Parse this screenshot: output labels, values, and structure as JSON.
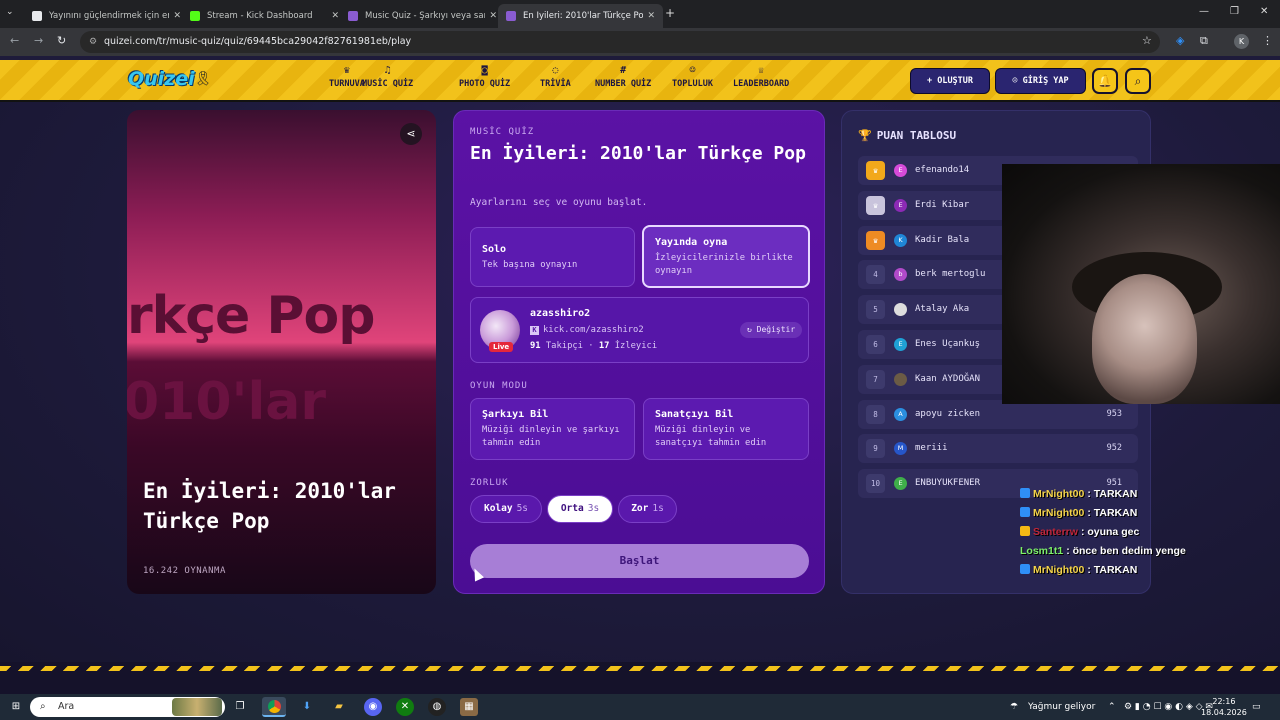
{
  "browser": {
    "tabs": [
      {
        "title": "Yayınını güçlendirmek için en iyi",
        "color": "#e8eaed"
      },
      {
        "title": "Stream - Kick Dashboard",
        "color": "#53fc18"
      },
      {
        "title": "Music Quiz - Şarkıyı veya sanatç",
        "color": "#8a5cd1"
      },
      {
        "title": "En İyileri: 2010'lar Türkçe Pop -",
        "color": "#8a5cd1"
      }
    ],
    "url": "quizei.com/tr/music-quiz/quiz/69445bca29042f82761981eb/play"
  },
  "site": {
    "logo": "Quizei",
    "nav": [
      {
        "icon": "♛",
        "label": "TURNUVA"
      },
      {
        "icon": "♫",
        "label": "MUSİC QUİZ"
      },
      {
        "icon": "◙",
        "label": "PHOTO QUİZ"
      },
      {
        "icon": "◌",
        "label": "TRİVİA"
      },
      {
        "icon": "#",
        "label": "NUMBER QUİZ"
      },
      {
        "icon": "☺",
        "label": "TOPLULUK"
      },
      {
        "icon": "♕",
        "label": "LEADERBOARD"
      }
    ],
    "create_label": "+ OLUŞTUR",
    "login_label": "GİRİŞ YAP"
  },
  "cover": {
    "bg_text1": "rkçe Pop",
    "bg_text2": "010'lar",
    "title": "En İyileri: 2010'lar Türkçe Pop",
    "plays": "16.242 OYNANMA"
  },
  "panel": {
    "kicker": "MUSİC QUİZ",
    "title": "En İyileri: 2010'lar Türkçe Pop",
    "subtitle": "Ayarlarını seç ve oyunu başlat.",
    "modes": [
      {
        "title": "Solo",
        "desc": "Tek başına oynayın"
      },
      {
        "title": "Yayında oyna",
        "desc": "İzleyicilerinizle birlikte oynayın"
      }
    ],
    "streamer": {
      "name": "azasshiro2",
      "live": "Live",
      "link": "kick.com/azasshiro2",
      "followers": "91",
      "followers_label": "Takipçi",
      "viewers": "17",
      "viewers_label": "İzleyici",
      "change_label": "Değiştir"
    },
    "game_mode_label": "OYUN MODU",
    "game_modes": [
      {
        "title": "Şarkıyı Bil",
        "desc": "Müziği dinleyin ve şarkıyı tahmin edin"
      },
      {
        "title": "Sanatçıyı Bil",
        "desc": "Müziği dinleyin ve sanatçıyı tahmin edin"
      }
    ],
    "difficulty_label": "ZORLUK",
    "difficulties": [
      {
        "label": "Kolay",
        "time": "5s"
      },
      {
        "label": "Orta",
        "time": "3s"
      },
      {
        "label": "Zor",
        "time": "1s"
      }
    ],
    "start_label": "Başlat"
  },
  "leaderboard": {
    "title": "PUAN TABLOSU",
    "rows": [
      {
        "rank": "♛",
        "initial": "E",
        "color": "#d64bd9",
        "name": "efenando14",
        "score": ""
      },
      {
        "rank": "♛",
        "initial": "E",
        "color": "#8c2ab5",
        "name": "Erdi Kibar",
        "score": ""
      },
      {
        "rank": "♛",
        "initial": "K",
        "color": "#1f86d6",
        "name": "Kadir Bala",
        "score": ""
      },
      {
        "rank": "4",
        "initial": "b",
        "color": "#b04ac9",
        "name": "berk mertoglu",
        "score": ""
      },
      {
        "rank": "5",
        "initial": "",
        "color": "#dddddd",
        "name": "Atalay Aka",
        "score": ""
      },
      {
        "rank": "6",
        "initial": "E",
        "color": "#1fa1d6",
        "name": "Enes Uçankuş",
        "score": ""
      },
      {
        "rank": "7",
        "initial": "",
        "color": "#6b5b45",
        "name": "Kaan AYDOĞAN",
        "score": ""
      },
      {
        "rank": "8",
        "initial": "A",
        "color": "#2b8fe0",
        "name": "apoyu zicken",
        "score": "953"
      },
      {
        "rank": "9",
        "initial": "M",
        "color": "#2656c9",
        "name": "meriii",
        "score": "952"
      },
      {
        "rank": "10",
        "initial": "E",
        "color": "#3fae4a",
        "name": "ENBUYUKFENER",
        "score": "951"
      }
    ]
  },
  "chat": [
    {
      "user": "MrNight00",
      "color": "#f5d44a",
      "text": ": TARKAN"
    },
    {
      "user": "MrNight00",
      "color": "#f5d44a",
      "text": ": TARKAN"
    },
    {
      "user": "Santerrw",
      "color": "#c0263a",
      "text": ": oyuna gec"
    },
    {
      "user": "Losm1t1",
      "color": "#7df06a",
      "text": ": önce ben dedim yenge"
    },
    {
      "user": "MrNight00",
      "color": "#f5d44a",
      "text": ": TARKAN"
    }
  ],
  "taskbar": {
    "search_placeholder": "Ara",
    "weather": "Yağmur geliyor",
    "time": "22:16",
    "date": "18.04.2026"
  }
}
